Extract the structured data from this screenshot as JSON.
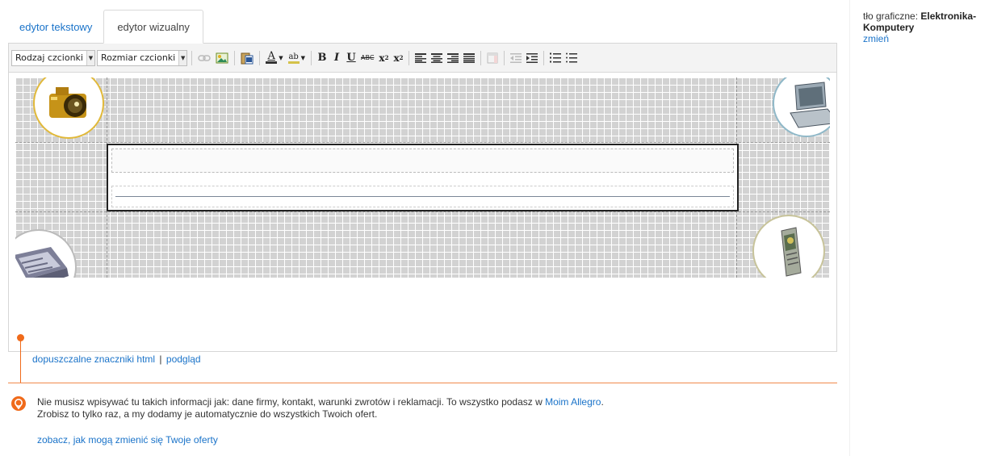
{
  "tabs": {
    "text_editor": "edytor tekstowy",
    "visual_editor": "edytor wizualny"
  },
  "toolbar": {
    "font_family": "Rodzaj czcionki",
    "font_size": "Rozmiar czcionki",
    "bold": "B",
    "italic": "I",
    "underline": "U",
    "strike": "ABC",
    "subscript": "x",
    "superscript": "x",
    "text_color_letter": "A",
    "highlight_letters": "ab"
  },
  "editor_links": {
    "allowed_html": "dopuszczalne znaczniki html",
    "separator": "|",
    "preview": "podgląd"
  },
  "info": {
    "line1_prefix": "Nie musisz wpisywać tu takich informacji jak: dane firmy, kontakt, warunki zwrotów i reklamacji. To wszystko podasz w ",
    "line1_link": "Moim Allegro",
    "line1_suffix": ".",
    "line2": "Zrobisz to tylko raz, a my dodamy je automatycznie do wszystkich Twoich ofert.",
    "see_link": "zobacz, jak mogą zmienić się Twoje oferty"
  },
  "right_panel": {
    "label": "tło graficzne: ",
    "value": "Elektronika-Komputery",
    "change_link": "zmień"
  },
  "colors": {
    "accent_orange": "#f06a1a",
    "link_blue": "#1a73c9"
  },
  "icons": [
    "link-icon",
    "image-icon",
    "paste-word-icon",
    "text-color-icon",
    "highlight-icon",
    "align-left-icon",
    "align-center-icon",
    "align-right-icon",
    "align-justify-icon",
    "table-icon",
    "outdent-icon",
    "indent-icon",
    "ordered-list-icon",
    "unordered-list-icon",
    "camera-icon",
    "laptop-icon",
    "keyboard-icon",
    "phone-icon",
    "info-icon"
  ]
}
